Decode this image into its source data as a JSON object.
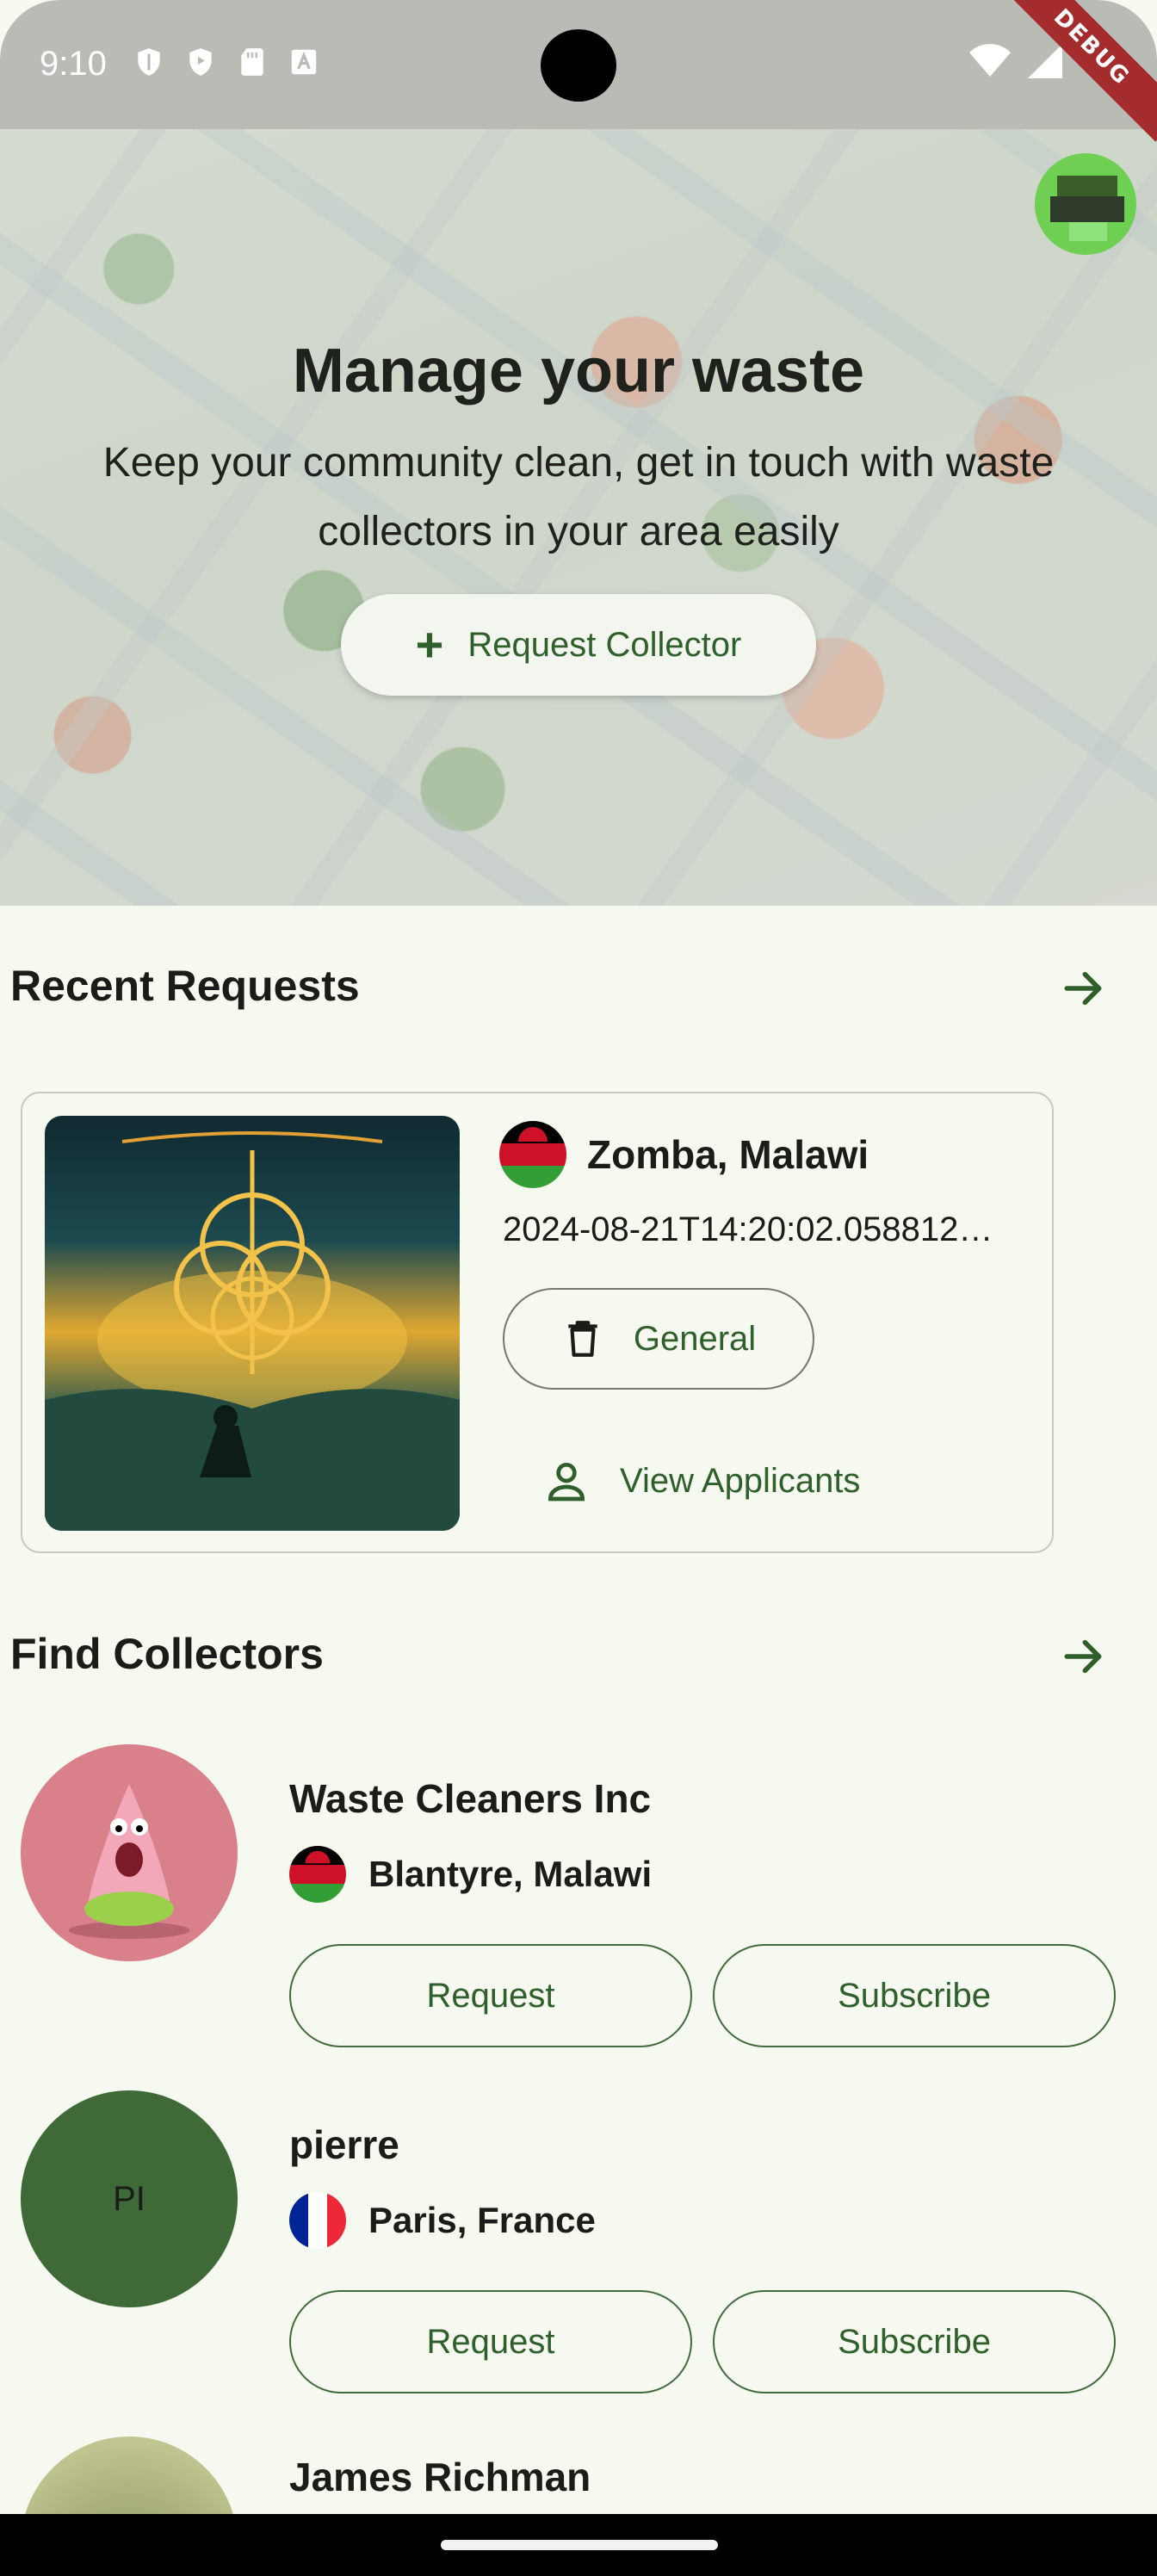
{
  "status_bar": {
    "time": "9:10",
    "debug_label": "DEBUG"
  },
  "hero": {
    "title": "Manage your waste",
    "subtitle": "Keep your community clean, get in touch with waste collectors in your area easily",
    "request_collector_label": "Request Collector"
  },
  "recent_requests": {
    "title": "Recent Requests",
    "items": [
      {
        "location": "Zomba, Malawi",
        "date": "2024-08-21T14:20:02.058812…",
        "category": "General",
        "view_applicants_label": "View Applicants"
      }
    ]
  },
  "find_collectors": {
    "title": "Find Collectors",
    "request_label": "Request",
    "subscribe_label": "Subscribe",
    "items": [
      {
        "name": "Waste Cleaners Inc",
        "location": "Blantyre, Malawi",
        "initials": ""
      },
      {
        "name": "pierre",
        "location": "Paris, France",
        "initials": "PI"
      },
      {
        "name": "James Richman",
        "location": "",
        "initials": ""
      }
    ]
  },
  "colors": {
    "primary": "#2f5f2b",
    "background": "#f5f9ef",
    "avatar_green": "#3f6a38",
    "avatar_pink": "#d9808a"
  }
}
